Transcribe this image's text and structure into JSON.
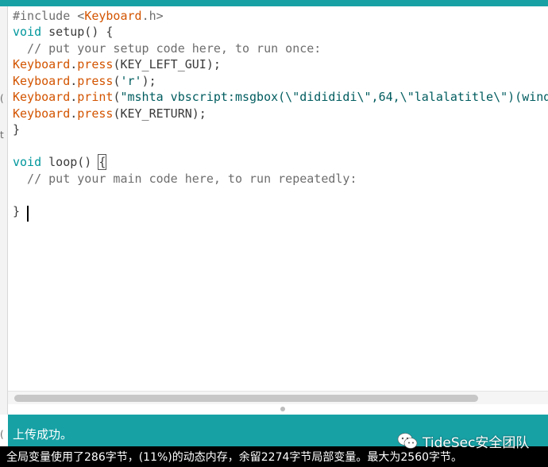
{
  "sidebar": {
    "marks": [
      "(",
      "t",
      "("
    ]
  },
  "code": {
    "line1_include": "#include <",
    "line1_lib": "Keyboard",
    "line1_end": ".h>",
    "line2_kw": "void",
    "line2_rest": " setup() {",
    "line3_comment": "  // put your setup code here, to run once:",
    "line4_obj": "Keyboard",
    "line4_dot": ".",
    "line4_fn": "press",
    "line4_args": "(KEY_LEFT_GUI);",
    "line5_obj": "Keyboard",
    "line5_dot": ".",
    "line5_fn": "press",
    "line5_open": "(",
    "line5_str": "'r'",
    "line5_close": ");",
    "line6_obj": "Keyboard",
    "line6_dot": ".",
    "line6_fn": "print",
    "line6_open": "(",
    "line6_str": "\"mshta vbscript:msgbox(\\\"didididi\\\",64,\\\"lalalatitle\\\")(wind",
    "line7_obj": "Keyboard",
    "line7_dot": ".",
    "line7_fn": "press",
    "line7_args": "(KEY_RETURN);",
    "line8": "}",
    "line10_kw": "void",
    "line10_rest": " loop() ",
    "line10_brace": "{",
    "line11_comment": "  // put your main code here, to run repeatedly:",
    "line13": "}"
  },
  "status": {
    "message": "上传成功。"
  },
  "console": {
    "text": "全局变量使用了286字节，(11%)的动态内存，余留2274字节局部变量。最大为2560字节。"
  },
  "watermark": {
    "text": "TideSec安全团队",
    "icon": "wechat-icon"
  },
  "colors": {
    "accent": "#17a1a5",
    "keyword": "#00979c",
    "function": "#d35400"
  }
}
